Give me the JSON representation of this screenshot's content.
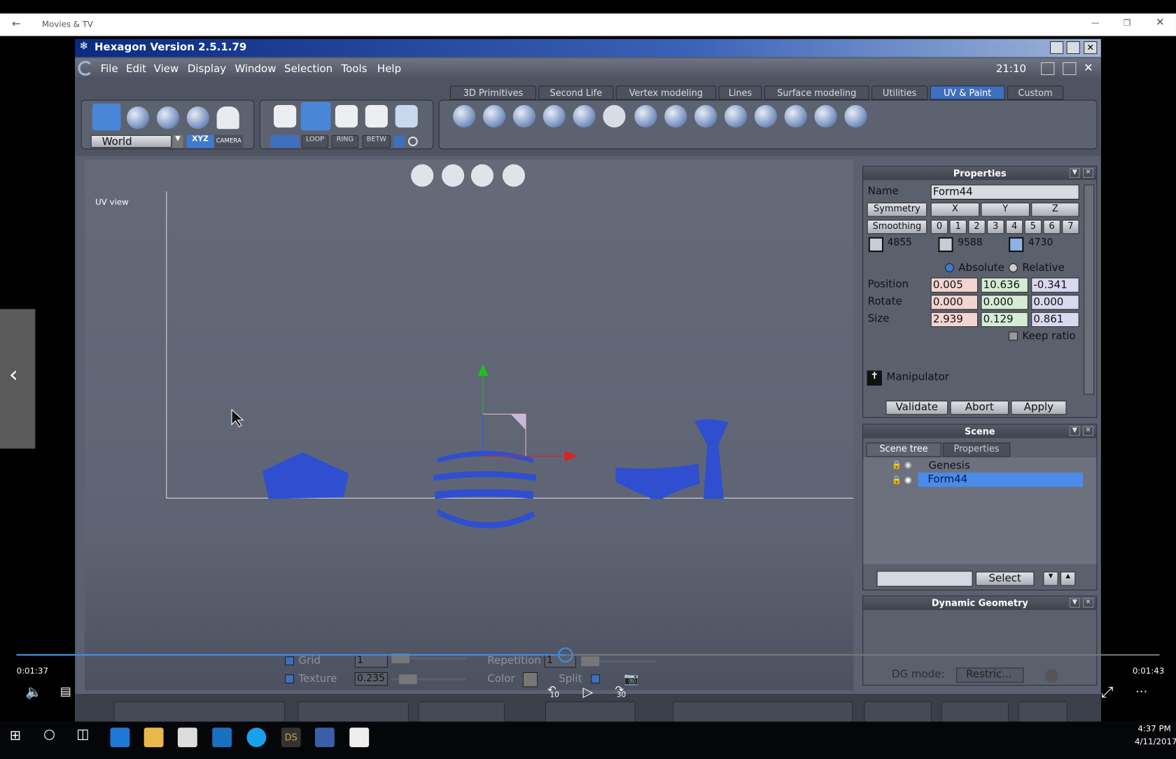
{
  "movies_app": {
    "title": "Movies & TV",
    "back_icon": "arrow-left-icon"
  },
  "window": {
    "title": "Hexagon Version 2.5.1.79",
    "clock": "21:10"
  },
  "menu": [
    "File",
    "Edit",
    "View",
    "Display",
    "Window",
    "Selection",
    "Tools",
    "Help"
  ],
  "toolbar": {
    "coord_space": "World",
    "xyz": "XYZ",
    "camera": "CAMERA",
    "edge_tools": [
      "LOOP",
      "RING",
      "BETW"
    ]
  },
  "tabs": [
    {
      "label": "3D Primitives",
      "active": false
    },
    {
      "label": "Second Life",
      "active": false
    },
    {
      "label": "Vertex modeling",
      "active": false
    },
    {
      "label": "Lines",
      "active": false
    },
    {
      "label": "Surface modeling",
      "active": false
    },
    {
      "label": "Utilities",
      "active": false
    },
    {
      "label": "UV & Paint",
      "active": true
    },
    {
      "label": "Custom",
      "active": false
    }
  ],
  "viewport": {
    "label": "UV view",
    "uv_color": "#2f4fd0"
  },
  "bottom_options": {
    "grid_label": "Grid",
    "grid_value": "1",
    "grid_checked": true,
    "texture_label": "Texture",
    "texture_value": "0.235",
    "texture_checked": true,
    "repetition_label": "Repetition",
    "repetition_value": "1",
    "color_label": "Color",
    "split_label": "Split",
    "split_checked": true
  },
  "properties": {
    "title": "Properties",
    "name_label": "Name",
    "name_value": "Form44",
    "symmetry_label": "Symmetry",
    "symmetry_axes": [
      "X",
      "Y",
      "Z"
    ],
    "smoothing_label": "Smoothing",
    "smoothing_levels": [
      "0",
      "1",
      "2",
      "3",
      "4",
      "5",
      "6",
      "7"
    ],
    "counts": [
      "4855",
      "9588",
      "4730"
    ],
    "absolute_label": "Absolute",
    "relative_label": "Relative",
    "mode": "Absolute",
    "position_label": "Position",
    "position": [
      "0.005",
      "10.636",
      "-0.341"
    ],
    "rotate_label": "Rotate",
    "rotate": [
      "0.000",
      "0.000",
      "0.000"
    ],
    "size_label": "Size",
    "size": [
      "2.939",
      "0.129",
      "0.861"
    ],
    "keep_ratio_label": "Keep ratio",
    "keep_ratio": false,
    "manipulator_label": "Manipulator",
    "validate": "Validate",
    "abort": "Abort",
    "apply": "Apply"
  },
  "scene": {
    "title": "Scene",
    "tabs": [
      "Scene tree",
      "Properties"
    ],
    "items": [
      {
        "label": "Genesis",
        "selected": false
      },
      {
        "label": "Form44",
        "selected": true
      }
    ],
    "select_button": "Select"
  },
  "dynamic_geometry": {
    "title": "Dynamic Geometry",
    "mode_label": "DG mode:",
    "mode_value": "Restric..."
  },
  "player": {
    "elapsed": "0:01:37",
    "remaining": "0:01:43",
    "progress": 0.48,
    "skip_back": "10",
    "skip_forward": "30"
  },
  "taskbar": {
    "time": "4:37 PM",
    "date": "4/11/2017",
    "ds_label": "DS"
  }
}
